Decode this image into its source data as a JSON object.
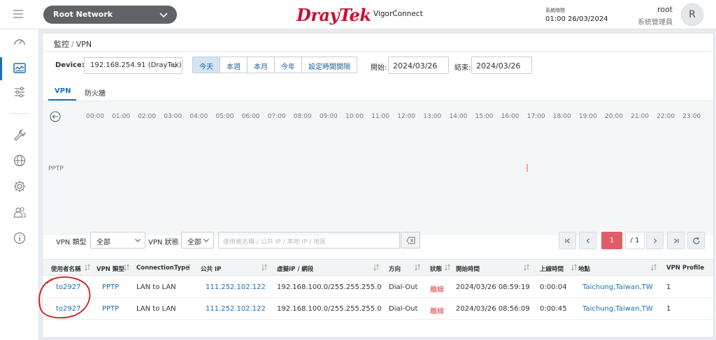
{
  "header": {
    "network": "Root Network",
    "logo": "DrayTek",
    "product": "VigorConnect",
    "sys_time_label": "系統時間",
    "sys_time": "01:00 26/03/2024",
    "user": "root",
    "role": "系統管理員",
    "avatar": "R"
  },
  "sidebar": {
    "items": [
      "gauge-icon",
      "monitor-icon",
      "sliders-icon",
      "wrench-icon",
      "globe-icon",
      "gear-icon",
      "users-icon",
      "info-icon"
    ],
    "active": "monitor-icon"
  },
  "breadcrumb": {
    "section": "監控",
    "page": "VPN"
  },
  "toolbar": {
    "device_label": "Device:",
    "device_value": "192.168.254.91 (DrayTek)",
    "ranges": [
      "今天",
      "本週",
      "本月",
      "今年",
      "設定時間間隔"
    ],
    "active_range": "今天",
    "start_label": "開始:",
    "start_value": "2024/03/26",
    "end_label": "結束:",
    "end_value": "2024/03/26"
  },
  "tabs": {
    "vpn": "VPN",
    "firewall": "防火牆"
  },
  "timeline": {
    "hours": [
      "00:00",
      "01:00",
      "02:00",
      "03:00",
      "04:00",
      "05:00",
      "06:00",
      "07:00",
      "08:00",
      "09:00",
      "10:00",
      "11:00",
      "12:00",
      "13:00",
      "14:00",
      "15:00",
      "16:00",
      "17:00",
      "18:00",
      "19:00",
      "20:00",
      "21:00",
      "22:00",
      "23:00"
    ],
    "row_label": "PPTP"
  },
  "filters": {
    "type_label": "VPN 類型",
    "type_value": "全部",
    "status_label": "VPN 狀態",
    "status_value": "全部",
    "search_placeholder": "使用者名稱 / 公共 IP / 本地 IP / 地區"
  },
  "pager": {
    "current": "1",
    "total": "/ 1"
  },
  "table": {
    "columns": [
      "使用者名稱",
      "VPN 類型",
      "ConnectionType",
      "公共 IP",
      "虛擬IP / 網段",
      "方向",
      "狀態",
      "開始時間",
      "上線時間",
      "地點",
      "VPN Profile"
    ],
    "rows": [
      {
        "user": "to2927",
        "type": "PPTP",
        "conn": "LAN to LAN",
        "public_ip": "111.252.102.122",
        "virtual_ip": "192.168.100.0/255.255.255.0",
        "direction": "Dial-Out",
        "status": "離線",
        "start": "2024/03/26 08:59:19",
        "uptime": "0:00:04",
        "location": "Taichung,Taiwan,TW",
        "profile": "1"
      },
      {
        "user": "to2927",
        "type": "PPTP",
        "conn": "LAN to LAN",
        "public_ip": "111.252.102.122",
        "virtual_ip": "192.168.100.0/255.255.255.0",
        "direction": "Dial-Out",
        "status": "離線",
        "start": "2024/03/26 08:56:09",
        "uptime": "0:00:45",
        "location": "Taichung,Taiwan,TW",
        "profile": "1"
      }
    ]
  },
  "colors": {
    "accent": "#1b6fb5",
    "brand": "#c8102e",
    "danger": "#e03c3c",
    "pager_active": "#e05c66"
  }
}
